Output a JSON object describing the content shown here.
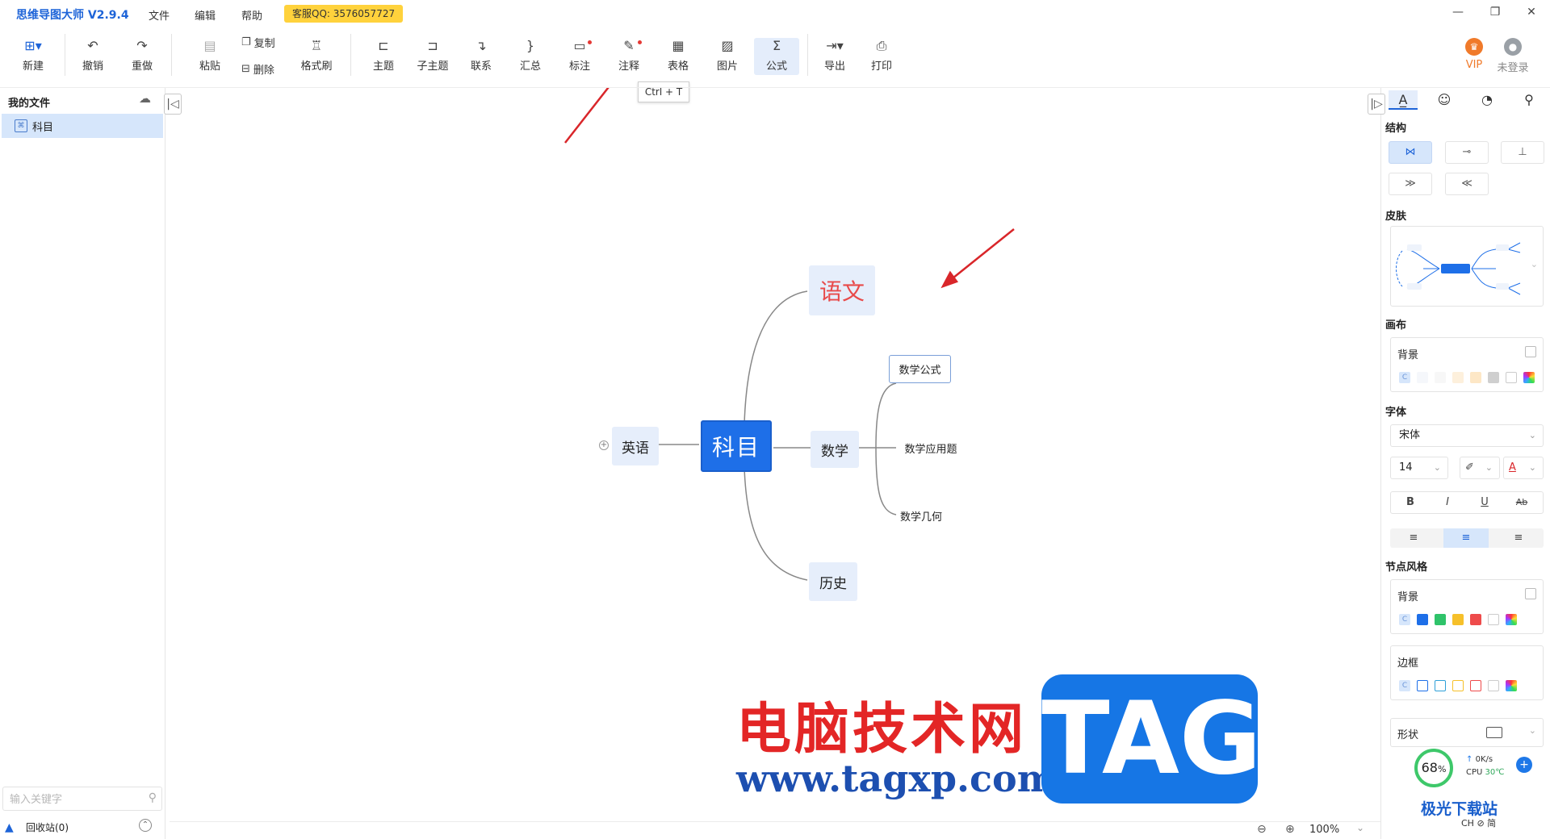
{
  "app": {
    "title": "思维导图大师 V2.9.4",
    "menu": [
      "文件",
      "编辑",
      "帮助"
    ],
    "qq_badge": "客服QQ: 3576057727",
    "window_controls": [
      "—",
      "❐",
      "✕"
    ]
  },
  "toolbar": {
    "new": "新建",
    "undo": "撤销",
    "redo": "重做",
    "paste": "粘贴",
    "copy": "复制",
    "delete": "删除",
    "format_painter": "格式刷",
    "topic": "主题",
    "subtopic": "子主题",
    "relation": "联系",
    "summary": "汇总",
    "callout": "标注",
    "note": "注释",
    "table": "表格",
    "image": "图片",
    "formula": "公式",
    "export": "导出",
    "print": "打印",
    "vip": "VIP",
    "login": "未登录",
    "tooltip": "Ctrl + T"
  },
  "left_panel": {
    "title": "我的文件",
    "files": [
      "科目"
    ],
    "search_placeholder": "输入关键字",
    "recycle": "回收站(0)"
  },
  "mindmap": {
    "root": "科目",
    "branches": [
      "语文",
      "数学",
      "历史",
      "英语"
    ],
    "math_children": [
      "数学公式",
      "数学应用题",
      "数学几何"
    ]
  },
  "status": {
    "zoom": "100%"
  },
  "right_panel": {
    "structure": "结构",
    "skin": "皮肤",
    "canvas": "画布",
    "canvas_bg": "背景",
    "font": "字体",
    "font_family": "宋体",
    "font_size": "14",
    "bold": "B",
    "italic": "I",
    "underline": "U",
    "strike": "Ab",
    "node_style": "节点风格",
    "node_bg": "背景",
    "border": "边框",
    "shape": "形状",
    "swatch_c": "C"
  },
  "watermark": {
    "cn": "电脑技术网",
    "url": "www.tagxp.com",
    "tag": "TAG",
    "logo": "极光下载站",
    "logo_sub": "CH ⊘ 简"
  },
  "cpu_widget": {
    "percent": "68",
    "unit": "%",
    "speed": "0K/s",
    "cpu_label": "CPU",
    "temp": "30℃"
  },
  "colors": {
    "accent": "#1e64d8",
    "root_node": "#1e6fe8",
    "sub_node_bg": "#e6eefb",
    "chinese_text": "#e84a4a",
    "arrow": "#d9262a",
    "qq_badge": "#ffd23c"
  },
  "icons": {
    "new": "plus-square-icon",
    "undo": "undo-arrow-icon",
    "redo": "redo-arrow-icon",
    "note": "pencil-icon",
    "table": "grid-icon",
    "image": "picture-icon",
    "formula": "sigma-icon",
    "export": "export-icon",
    "print": "printer-icon"
  }
}
